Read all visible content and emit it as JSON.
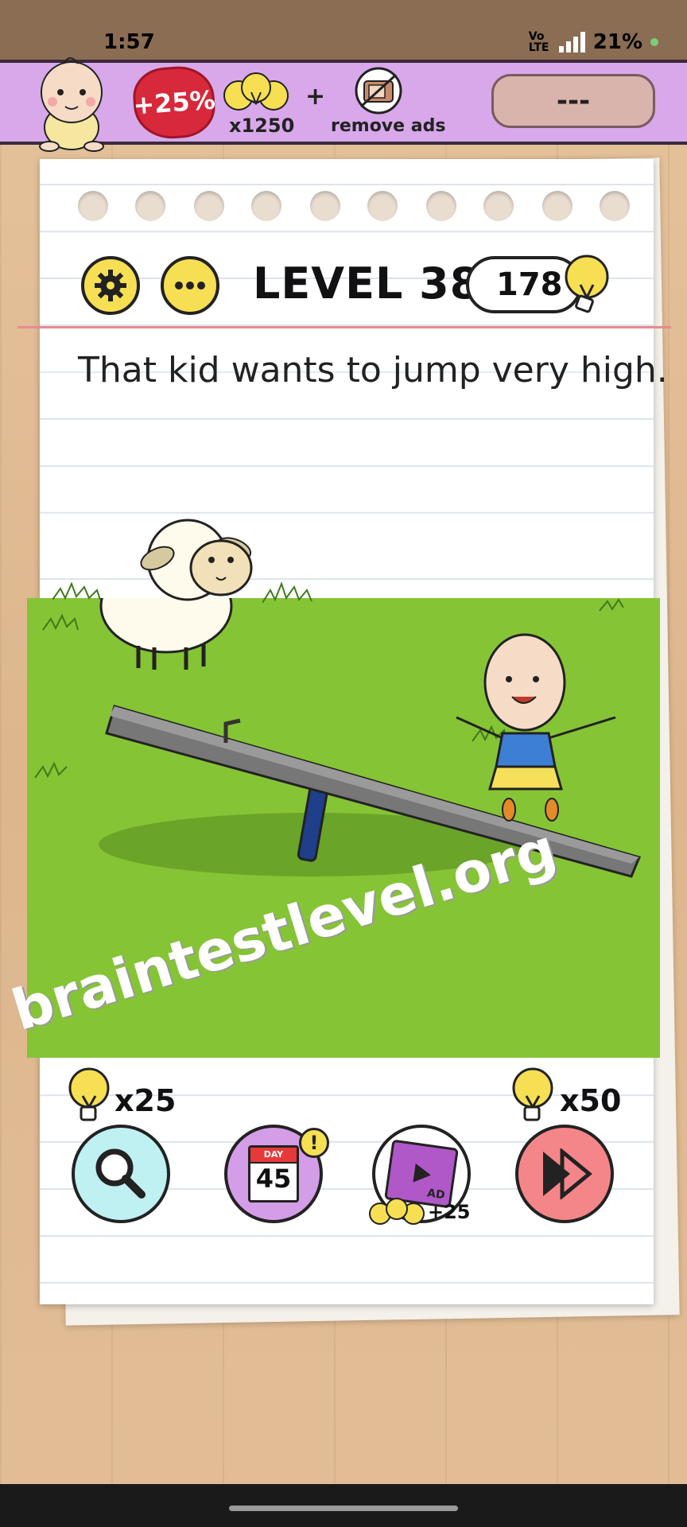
{
  "status_bar": {
    "time": "1:57",
    "network": "Vo LTE",
    "battery": "21%"
  },
  "promo": {
    "discount": "+25%",
    "bulb_count": "x1250",
    "plus": "+",
    "remove_ads": "remove ads",
    "price": "---"
  },
  "header": {
    "level": "LEVEL 387",
    "hints": "178"
  },
  "question": "That kid wants to jump very high.",
  "watermark": "braintestlevel.org",
  "tools": {
    "search_cost": "x25",
    "calendar_day_label": "DAY",
    "calendar_day": "45",
    "ad_label": "AD",
    "ad_reward": "+25",
    "skip_cost": "x50"
  },
  "colors": {
    "grass": "#85c435",
    "banner": "#d8a8ea",
    "bulb": "#f7df53",
    "search_bg": "#bff0f2",
    "calendar_bg": "#d49de8",
    "skip_bg": "#f4868a"
  }
}
